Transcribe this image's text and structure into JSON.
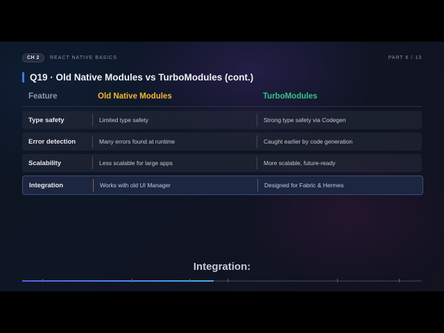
{
  "header": {
    "chapter_badge": "CH 2",
    "chapter_title": "REACT NATIVE BASICS",
    "part": "PART 6 / 13"
  },
  "slide": {
    "title": "Q19 · Old Native Modules vs TurboModules (cont.)"
  },
  "table": {
    "columns": [
      "Feature",
      "Old Native Modules",
      "TurboModules"
    ],
    "rows": [
      {
        "feature": "Type safety",
        "old": "Limited type safety",
        "turbo": "Strong type safety via Codegen"
      },
      {
        "feature": "Error detection",
        "old": "Many errors found at runtime",
        "turbo": "Caught earlier by code generation"
      },
      {
        "feature": "Scalability",
        "old": "Less scalable for large apps",
        "turbo": "More scalable, future-ready"
      },
      {
        "feature": "Integration",
        "old": "Works with old UI Manager",
        "turbo": "Designed for Fabric & Hermes"
      }
    ],
    "highlighted_row": 3
  },
  "caption": "Integration:",
  "progress": {
    "fraction": 0.48
  },
  "colors": {
    "accent": "#3d7bf0",
    "old_header": "#f5b82e",
    "turbo_header": "#33c58a",
    "background": "#0f1524"
  }
}
